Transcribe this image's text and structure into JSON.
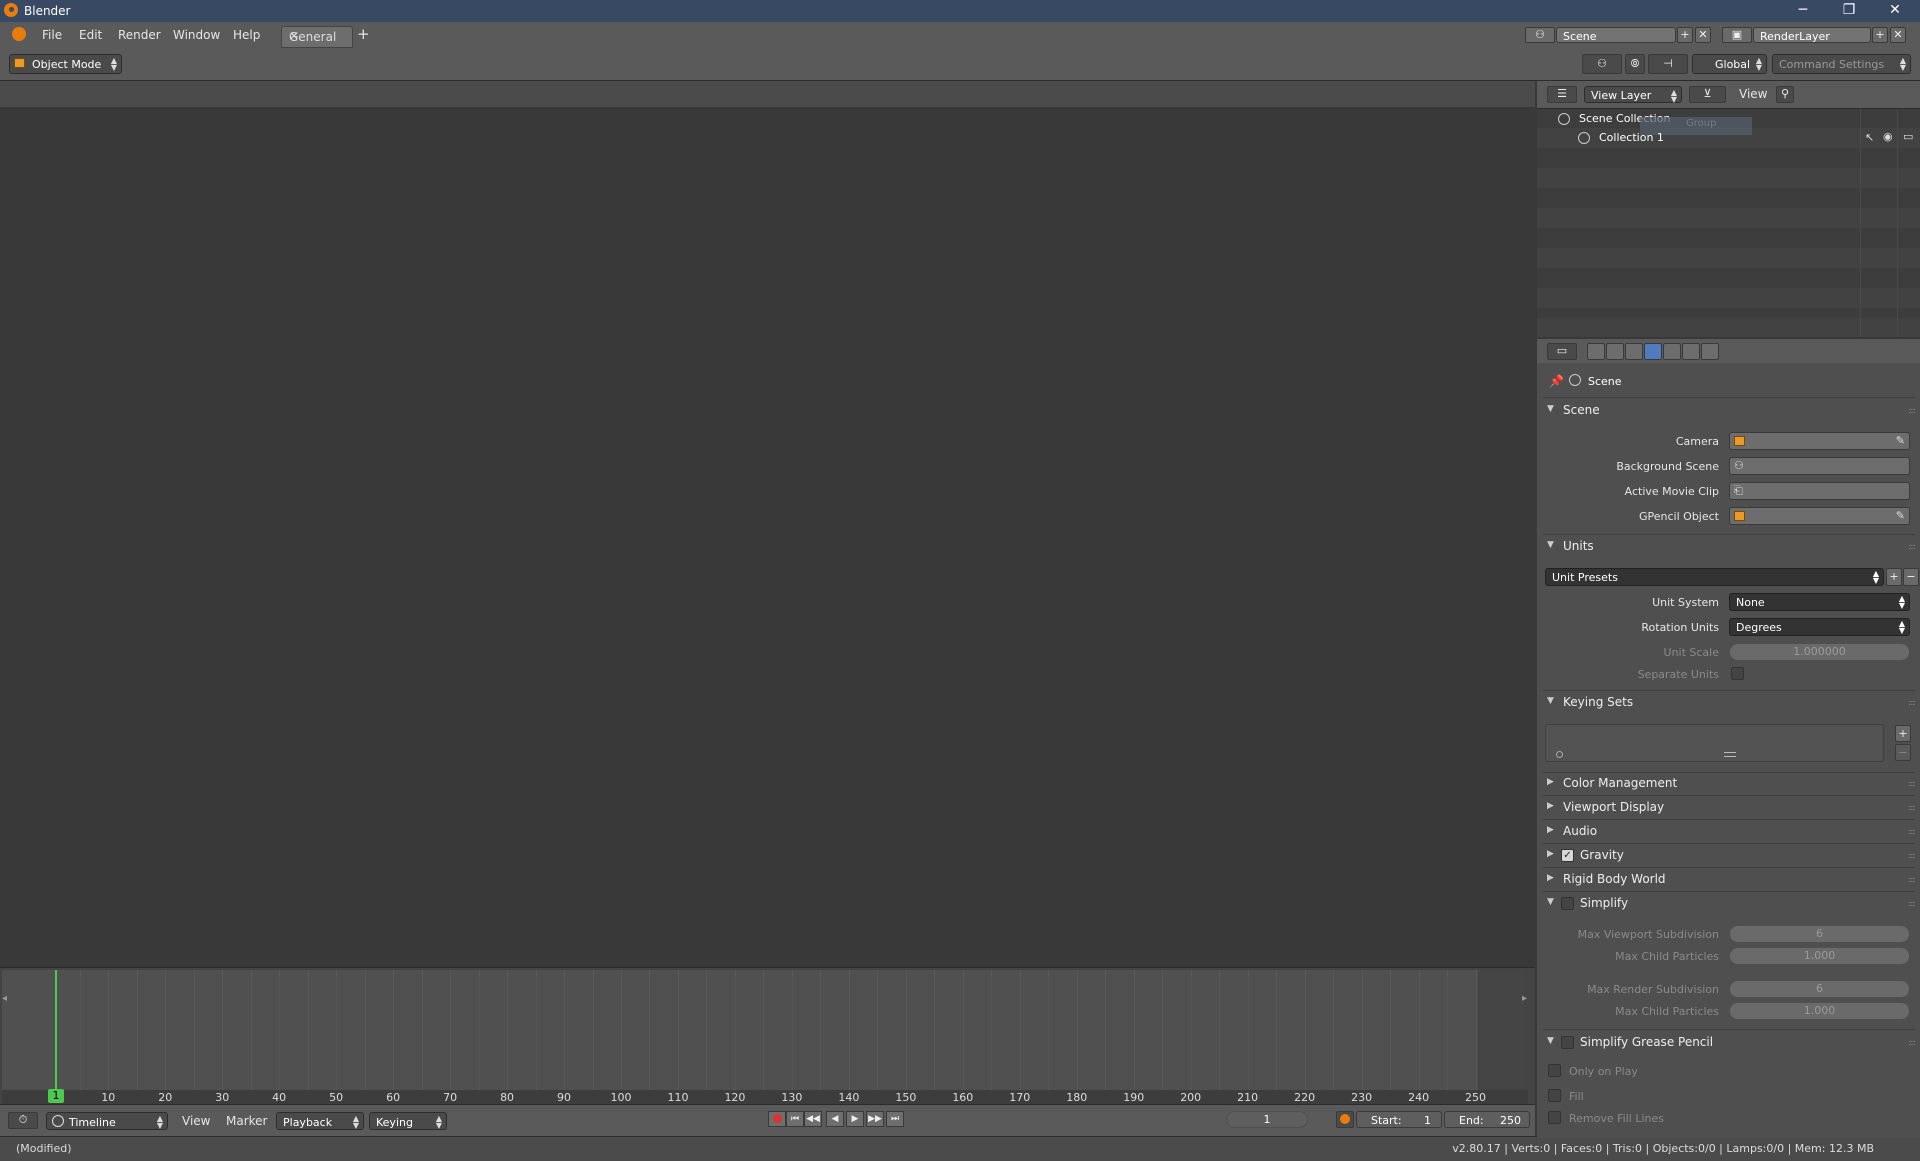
{
  "app": {
    "title": "Blender"
  },
  "window_controls": {
    "minimize": "─",
    "maximize": "❐",
    "close": "✕"
  },
  "menubar": {
    "items": [
      "File",
      "Edit",
      "Render",
      "Window",
      "Help"
    ],
    "workspace_tab": "General",
    "add_tab": "+",
    "scene": "Scene",
    "render_layer": "RenderLayer"
  },
  "header": {
    "mode": "Object Mode",
    "orientation": "Global",
    "command_settings": "Command Settings"
  },
  "outliner": {
    "view_layer": "View Layer",
    "view_menu": "View",
    "scene_collection": "Scene Collection",
    "collection": "Collection 1",
    "ghost_text": "Group"
  },
  "properties": {
    "context": "Scene",
    "scene_panel": {
      "title": "Scene",
      "fields": [
        "Camera",
        "Background Scene",
        "Active Movie Clip",
        "GPencil Object"
      ]
    },
    "units_panel": {
      "title": "Units",
      "presets": "Unit Presets",
      "unit_system_label": "Unit System",
      "unit_system": "None",
      "rotation_units_label": "Rotation Units",
      "rotation_units": "Degrees",
      "unit_scale_label": "Unit Scale",
      "unit_scale": "1.000000",
      "separate_units_label": "Separate Units"
    },
    "keying_sets_title": "Keying Sets",
    "collapsed_panels": [
      "Color Management",
      "Viewport Display",
      "Audio",
      "Gravity",
      "Rigid Body World"
    ],
    "simplify": {
      "title": "Simplify",
      "max_viewport_subdiv_label": "Max Viewport Subdivision",
      "max_viewport_subdiv": "6",
      "max_child_particles_label": "Max Child Particles",
      "max_child_particles": "1.000",
      "max_render_subdiv_label": "Max Render Subdivision",
      "max_render_subdiv": "6",
      "max_child_particles_render": "1.000"
    },
    "simplify_gp": {
      "title": "Simplify Grease Pencil",
      "only_on_play": "Only on Play",
      "fill": "Fill",
      "remove_fill_lines": "Remove Fill Lines"
    }
  },
  "timeline": {
    "ticks": [
      "10",
      "20",
      "30",
      "40",
      "50",
      "60",
      "70",
      "80",
      "90",
      "100",
      "110",
      "120",
      "130",
      "140",
      "150",
      "160",
      "170",
      "180",
      "190",
      "200",
      "210",
      "220",
      "230",
      "240",
      "250"
    ],
    "current_frame_marker": "1",
    "editor": "Timeline",
    "menus": [
      "View",
      "Marker"
    ],
    "playback": "Playback",
    "keying": "Keying",
    "current_frame": "1",
    "start_label": "Start:",
    "start": "1",
    "end_label": "End:",
    "end": "250"
  },
  "statusbar": {
    "left": "(Modified)",
    "right": "v2.80.17 | Verts:0 | Faces:0 | Tris:0 | Objects:0/0 | Lamps:0/0 | Mem: 12.3 MB"
  }
}
